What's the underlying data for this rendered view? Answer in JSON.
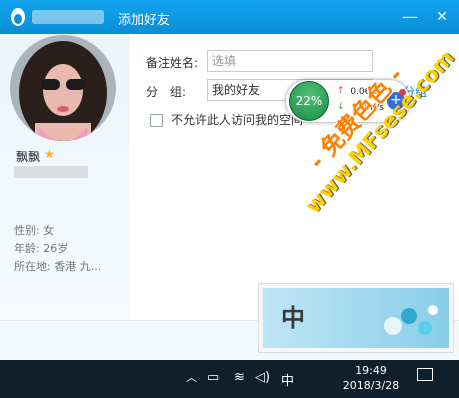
{
  "window": {
    "title": "添加好友",
    "minimize_glyph": "—",
    "close_glyph": "✕"
  },
  "profile": {
    "nickname": "飘飘",
    "star_glyph": "★",
    "gender": "性别: 女",
    "age": "年龄: 26岁",
    "location": "所在地: 香港  九..."
  },
  "form": {
    "remark_label": "备注姓名:",
    "remark_placeholder": "选填",
    "group_label": "分　组:",
    "group_value": "我的好友",
    "add_group_link": "分组",
    "checkbox_label": "不允许此人访问我的空间"
  },
  "speed_widget": {
    "percent": "22%",
    "upload": "0.06K/s",
    "download": "0K/s",
    "up_glyph": "↑",
    "down_glyph": "↓",
    "plus_glyph": "+"
  },
  "ad": {
    "char": "中"
  },
  "watermark": {
    "line1": "- 免费色色 -",
    "line2": "www.MFsese.com"
  },
  "taskbar": {
    "chevron": "︿",
    "ime_label": "中",
    "time": "19:49",
    "date": "2018/3/28",
    "battery_glyph": "▭",
    "wifi_glyph": "≋",
    "volume_glyph": "◁)"
  },
  "colors": {
    "titlebar": "#0b8ed6",
    "accent_link": "#1a7ed0",
    "speed_green": "#198a44",
    "taskbar": "#0f1f2b"
  },
  "icons": [
    "qq-logo-icon",
    "minimize-icon",
    "close-icon",
    "star-icon",
    "plus-icon",
    "chevron-up-icon",
    "battery-icon",
    "wifi-icon",
    "volume-icon",
    "notification-icon"
  ]
}
